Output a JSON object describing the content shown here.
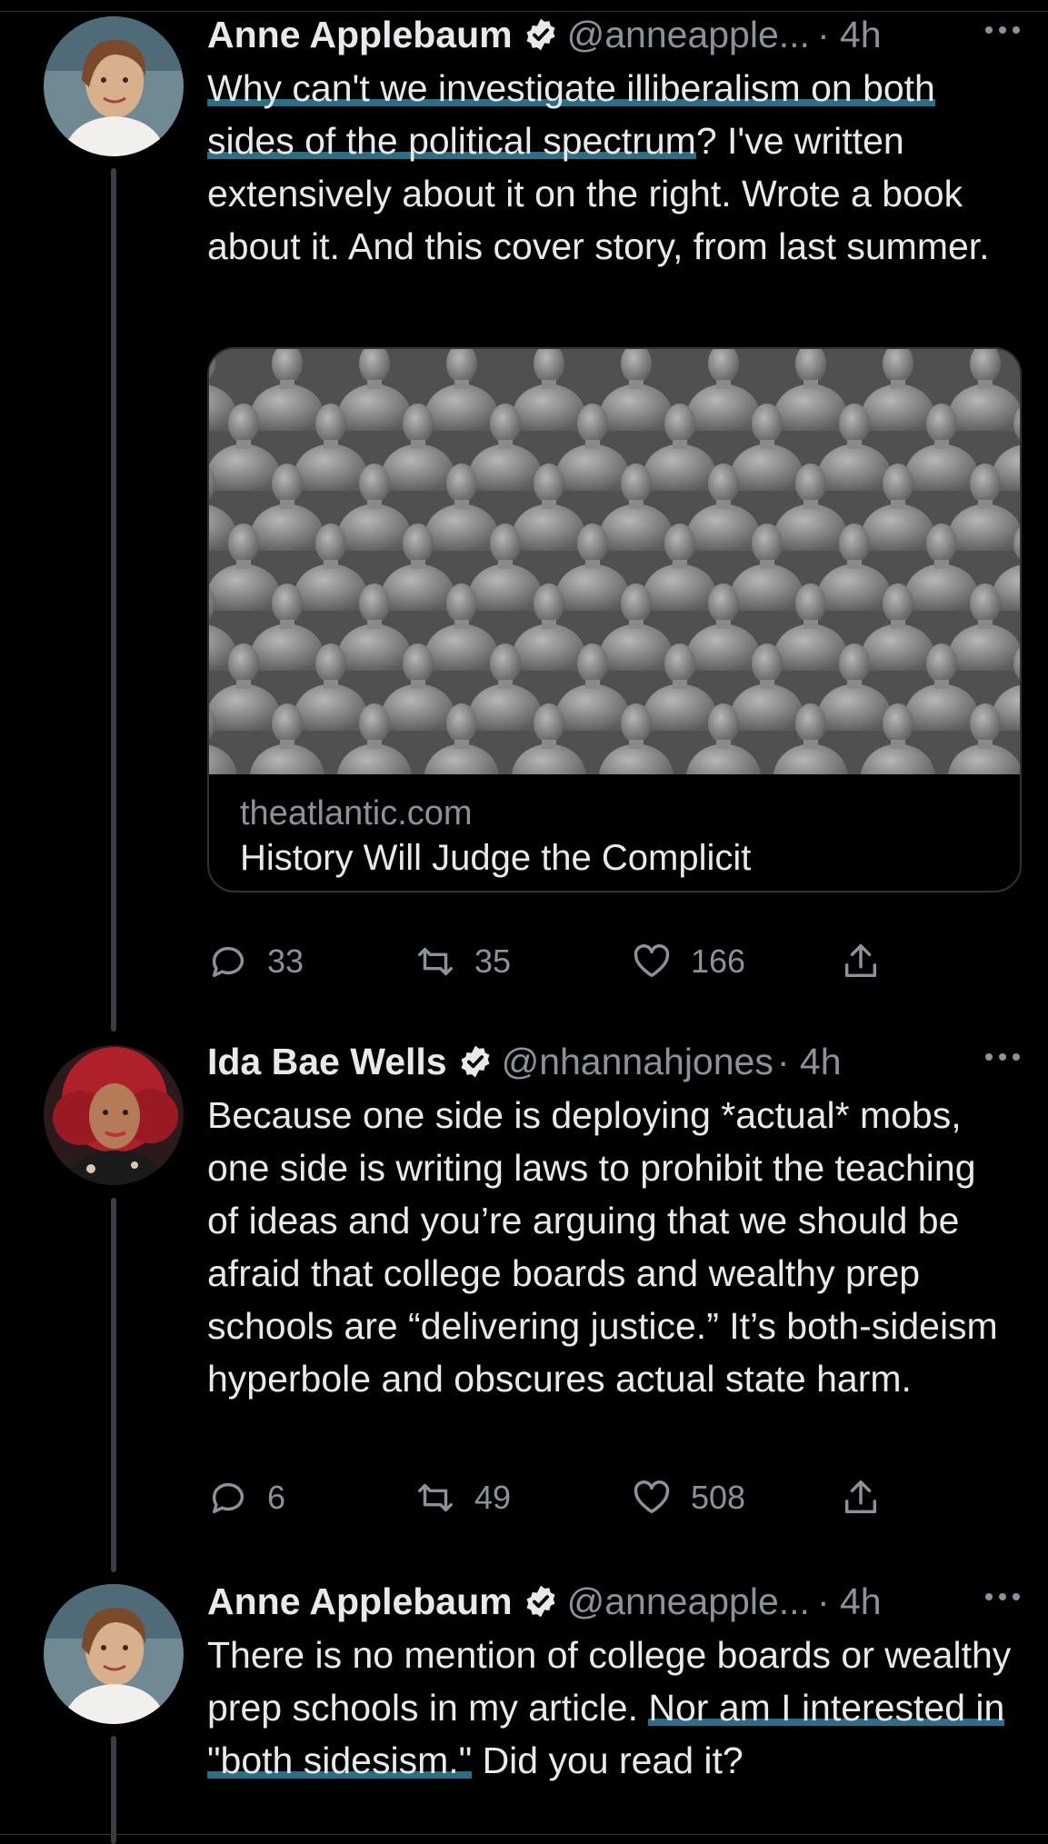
{
  "tweets": [
    {
      "name": "Anne Applebaum",
      "handle": "@anneapple...",
      "time": "· 4h",
      "text_highlight": "Why can't we investigate illiberalism on both sides of the political spectrum",
      "text_rest": "? I've written extensively about it on the right. Wrote a book about it. And this cover story, from last summer.",
      "card": {
        "domain": "theatlantic.com",
        "title": "History Will Judge the Complicit"
      },
      "replies": "33",
      "retweets": "35",
      "likes": "166"
    },
    {
      "name": "Ida Bae Wells",
      "handle": "@nhannahjones",
      "time": "· 4h",
      "text": "Because one side is deploying *actual* mobs, one side is writing laws to prohibit the teaching of ideas and you’re arguing that we should be afraid that college boards and wealthy prep schools are “delivering justice.” It’s both-sideism hyperbole and obscures actual state harm.",
      "replies": "6",
      "retweets": "49",
      "likes": "508"
    },
    {
      "name": "Anne Applebaum",
      "handle": "@anneapple...",
      "time": "· 4h",
      "text_before": "There is no mention of college boards or wealthy prep schools in my article. ",
      "text_highlight": "Nor am I interested in \"both sidesism.\"",
      "text_after": " Did you read it?"
    }
  ],
  "icons": {
    "verified": "verified-badge-icon",
    "more": "more-dots-icon",
    "reply": "reply-icon",
    "retweet": "retweet-icon",
    "like": "heart-icon",
    "share": "share-icon"
  },
  "colors": {
    "background": "#000000",
    "secondary_text": "#8b9299",
    "highlight": "#2a6f86"
  }
}
